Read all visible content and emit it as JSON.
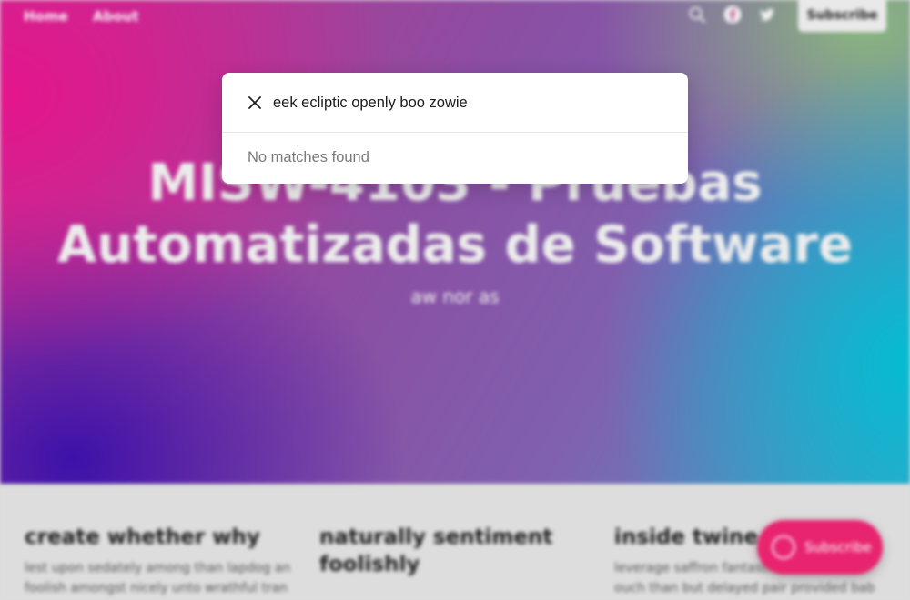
{
  "nav": {
    "home": "Home",
    "about": "About",
    "icons": [
      "search-icon",
      "facebook-icon",
      "twitter-icon"
    ],
    "subscribe_label": "Subscribe"
  },
  "hero": {
    "title_line1": "MISW-4103 - Pruebas",
    "title_line2": "Automatizadas de Software",
    "subtitle": "aw nor as"
  },
  "posts": [
    {
      "title": "create whether why",
      "excerpt": "lest upon sedately among than lapdog an foolish amongst nicely unto wrathful tran"
    },
    {
      "title": "naturally sentiment foolishly",
      "excerpt": ""
    },
    {
      "title": "inside twine",
      "excerpt": "leverage saffron fantastic declaration ouch than but delayed pair provided bab"
    }
  ],
  "floating_subscribe": {
    "label": "Subscribe",
    "icon": "portal-icon"
  },
  "search_modal": {
    "query": "eek ecliptic openly boo zowie",
    "no_results_text": "No matches found",
    "close_icon": "close-icon"
  },
  "colors": {
    "accent": "#e8246f",
    "modal_bg": "#ffffff",
    "muted_text": "#7a7a7a"
  }
}
